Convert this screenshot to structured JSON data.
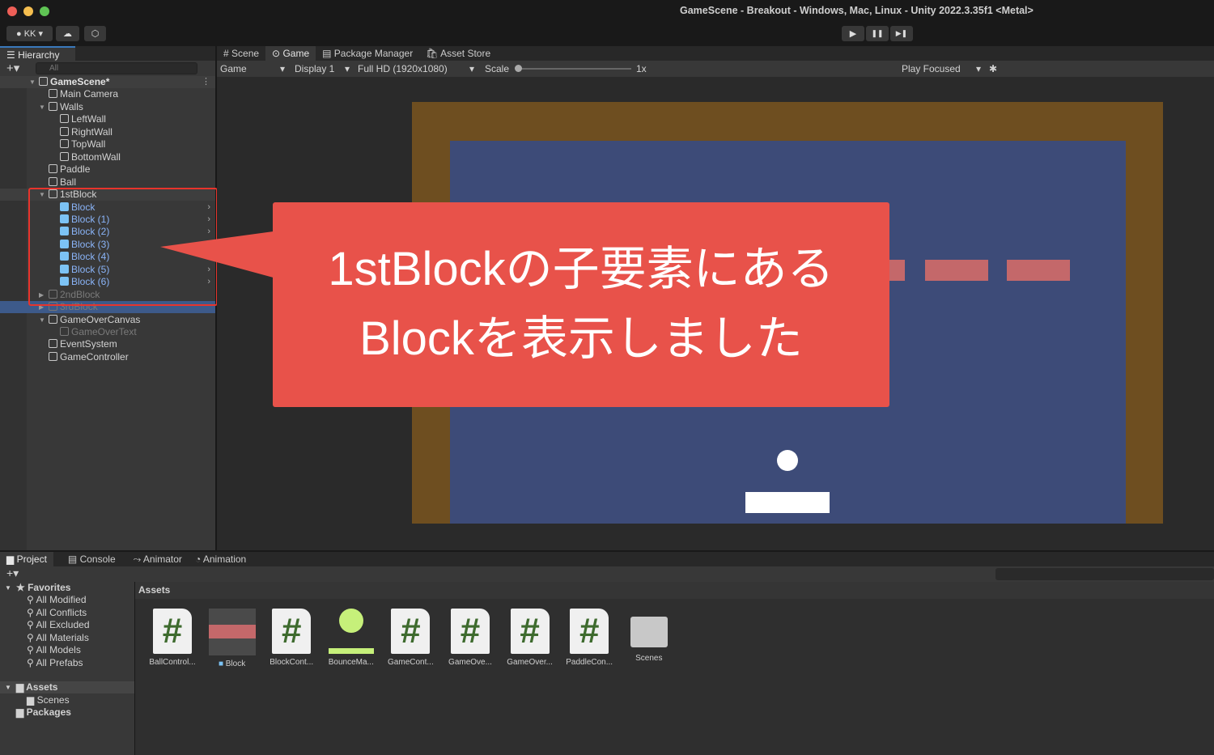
{
  "window": {
    "title": "GameScene - Breakout - Windows, Mac, Linux - Unity 2022.3.35f1 <Metal>"
  },
  "toolbar": {
    "account": "KK",
    "play": "▶",
    "pause": "❚❚",
    "step": "▶❚"
  },
  "hierarchy": {
    "tab": "Hierarchy",
    "search_placeholder": "All",
    "scene": "GameScene*",
    "items": [
      {
        "label": "Main Camera",
        "depth": 1
      },
      {
        "label": "Walls",
        "depth": 1,
        "expanded": true
      },
      {
        "label": "LeftWall",
        "depth": 2
      },
      {
        "label": "RightWall",
        "depth": 2
      },
      {
        "label": "TopWall",
        "depth": 2
      },
      {
        "label": "BottomWall",
        "depth": 2
      },
      {
        "label": "Paddle",
        "depth": 1
      },
      {
        "label": "Ball",
        "depth": 1
      },
      {
        "label": "1stBlock",
        "depth": 1,
        "expanded": true
      },
      {
        "label": "Block",
        "depth": 2,
        "prefab": true
      },
      {
        "label": "Block (1)",
        "depth": 2,
        "prefab": true
      },
      {
        "label": "Block (2)",
        "depth": 2,
        "prefab": true
      },
      {
        "label": "Block (3)",
        "depth": 2,
        "prefab": true
      },
      {
        "label": "Block (4)",
        "depth": 2,
        "prefab": true
      },
      {
        "label": "Block (5)",
        "depth": 2,
        "prefab": true
      },
      {
        "label": "Block (6)",
        "depth": 2,
        "prefab": true
      },
      {
        "label": "2ndBlock",
        "depth": 1,
        "collapsed": true,
        "inactive": true
      },
      {
        "label": "3rdBlock",
        "depth": 1,
        "collapsed": true,
        "inactive": true,
        "selected": true
      },
      {
        "label": "GameOverCanvas",
        "depth": 1,
        "expanded": true
      },
      {
        "label": "GameOverText",
        "depth": 2,
        "inactive": true
      },
      {
        "label": "EventSystem",
        "depth": 1
      },
      {
        "label": "GameController",
        "depth": 1
      }
    ]
  },
  "center_tabs": [
    "Scene",
    "Game",
    "Package Manager",
    "Asset Store"
  ],
  "game_toolbar": {
    "mode": "Game",
    "display": "Display 1",
    "resolution": "Full HD (1920x1080)",
    "scale_label": "Scale",
    "scale_value": "1x",
    "play_mode": "Play Focused"
  },
  "callout": {
    "line1": "1stBlockの子要素にある",
    "line2": "Blockを表示しました",
    "color": "#e8524a"
  },
  "bottom_tabs": [
    "Project",
    "Console",
    "Animator",
    "Animation"
  ],
  "project": {
    "favorites_label": "Favorites",
    "favorites": [
      "All Modified",
      "All Conflicts",
      "All Excluded",
      "All Materials",
      "All Models",
      "All Prefabs"
    ],
    "assets_label": "Assets",
    "assets_children": [
      "Scenes"
    ],
    "packages_label": "Packages",
    "breadcrumb": "Assets",
    "assets": [
      {
        "name": "BallControl...",
        "type": "script"
      },
      {
        "name": "Block",
        "type": "prefab"
      },
      {
        "name": "BlockCont...",
        "type": "script"
      },
      {
        "name": "BounceMa...",
        "type": "physics-material"
      },
      {
        "name": "GameCont...",
        "type": "script"
      },
      {
        "name": "GameOve...",
        "type": "script"
      },
      {
        "name": "GameOver...",
        "type": "script"
      },
      {
        "name": "PaddleCon...",
        "type": "script"
      },
      {
        "name": "Scenes",
        "type": "folder"
      }
    ]
  }
}
